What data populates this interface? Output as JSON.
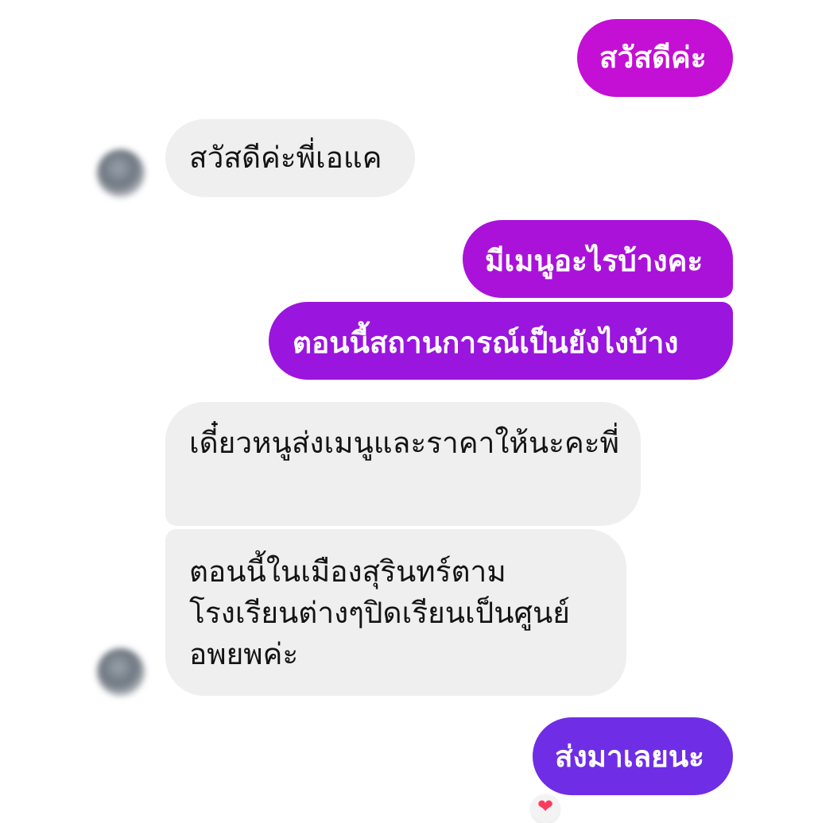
{
  "messages": [
    {
      "text": "สวัสดีค่ะ"
    },
    {
      "text": "สวัสดีค่ะพี่เอแค"
    },
    {
      "text": "มีเมนูอะไรบ้างคะ"
    },
    {
      "text": "ตอนนี้สถานการณ์เป็นยังไงบ้าง"
    },
    {
      "text": "เดี๋ยวหนูส่งเมนูและราคาให้นะคะพี่"
    },
    {
      "text": "ตอนนี้ในเมืองสุรินทร์ตามโรงเรียนต่างๆปิดเรียนเป็นศูนย์อพยพค่ะ"
    },
    {
      "text": "ส่งมาเลยนะ"
    }
  ],
  "reaction": {
    "icon": "heart-icon",
    "glyph": "❤"
  },
  "colors": {
    "outgoing_top": "#c40fd4",
    "outgoing_mid": "#9a15dd",
    "outgoing_bottom": "#6f2de6",
    "incoming_bg": "#efefef"
  }
}
